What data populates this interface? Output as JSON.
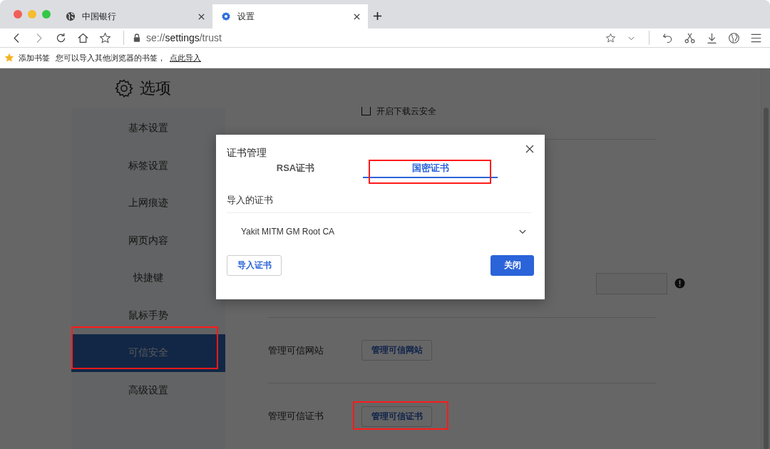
{
  "browser": {
    "tabs": [
      {
        "title": "中国银行",
        "kind": "web",
        "selected": false
      },
      {
        "title": "设置",
        "kind": "settings",
        "selected": true
      }
    ],
    "address": {
      "scheme": "se://",
      "host": "settings",
      "path": "/trust"
    }
  },
  "bookmarks_bar": {
    "label": "添加书签",
    "hint": "您可以导入其他浏览器的书签，",
    "link": "点此导入"
  },
  "page": {
    "title": "选项",
    "nav": [
      {
        "label": "基本设置",
        "selected": false
      },
      {
        "label": "标签设置",
        "selected": false
      },
      {
        "label": "上网痕迹",
        "selected": false
      },
      {
        "label": "网页内容",
        "selected": false
      },
      {
        "label": "快捷键",
        "selected": false
      },
      {
        "label": "鼠标手势",
        "selected": false
      },
      {
        "label": "可信安全",
        "selected": true
      },
      {
        "label": "高级设置",
        "selected": false
      }
    ],
    "download_security": {
      "label": "开启下载云安全",
      "checked": false
    },
    "rows": [
      {
        "label": "管理可信网站",
        "button": "管理可信网站"
      },
      {
        "label": "管理可信证书",
        "button": "管理可信证书"
      }
    ]
  },
  "dialog": {
    "title": "证书管理",
    "tabs": [
      {
        "label": "RSA证书",
        "selected": false
      },
      {
        "label": "国密证书",
        "selected": true
      }
    ],
    "section": "导入的证书",
    "certificate": "Yakit MITM GM Root CA",
    "import_button": "导入证书",
    "close_button": "关闭"
  }
}
